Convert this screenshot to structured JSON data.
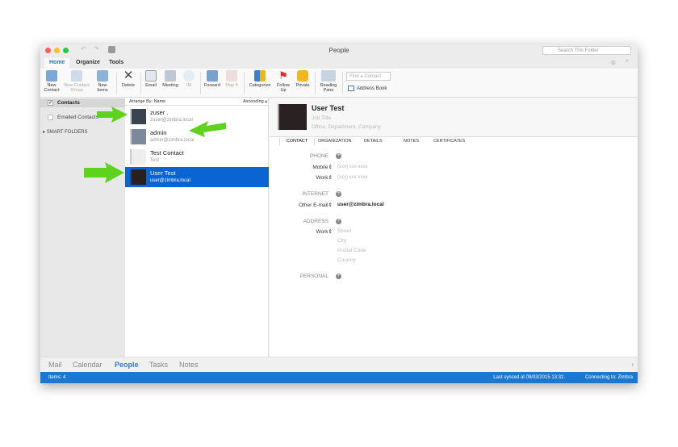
{
  "window": {
    "title": "People",
    "search_placeholder": "Search This Folder"
  },
  "tabs": [
    "Home",
    "Organize",
    "Tools"
  ],
  "ribbon": [
    {
      "label": "New Contact",
      "icon": "new-contact-icon",
      "enabled": true
    },
    {
      "label": "New Contact Group",
      "icon": "new-group-icon",
      "enabled": false
    },
    {
      "label": "New Items",
      "icon": "new-items-icon",
      "enabled": true
    },
    {
      "label": "Delete",
      "icon": "delete-icon",
      "enabled": true
    },
    {
      "label": "Email",
      "icon": "email-icon",
      "enabled": true
    },
    {
      "label": "Meeting",
      "icon": "meeting-icon",
      "enabled": true
    },
    {
      "label": "IM",
      "icon": "im-icon",
      "enabled": false
    },
    {
      "label": "Forward",
      "icon": "forward-icon",
      "enabled": true
    },
    {
      "label": "Map It",
      "icon": "map-icon",
      "enabled": false
    },
    {
      "label": "Categorize",
      "icon": "categorize-icon",
      "enabled": true
    },
    {
      "label": "Follow Up",
      "icon": "flag-icon",
      "enabled": true
    },
    {
      "label": "Private",
      "icon": "lock-icon",
      "enabled": true
    },
    {
      "label": "Reading Pane",
      "icon": "reading-pane-icon",
      "enabled": true
    }
  ],
  "find_contact_placeholder": "Find a Contact",
  "address_book": "Address Book",
  "sidebar": {
    "contacts": "Contacts",
    "emailed": "Emailed Contacts",
    "smart": "SMART FOLDERS"
  },
  "list": {
    "arrange": "Arrange By: Name",
    "order": "Ascending",
    "items": [
      {
        "name": "zuser .",
        "email": "zuser@zimbra.local"
      },
      {
        "name": "admin",
        "email": "admin@zimbra.local"
      },
      {
        "name": "Test Contact",
        "email": "Test"
      },
      {
        "name": "User Test",
        "email": "user@zimbra.local",
        "selected": true
      }
    ]
  },
  "detail": {
    "name": "User Test",
    "job_title": "Job Title",
    "office": "Office,  Department,  Company",
    "tabs": [
      "CONTACT",
      "ORGANIZATION",
      "DETAILS",
      "NOTES",
      "CERTIFICATES"
    ],
    "phone": "PHONE",
    "mobile": "Mobile",
    "work": "Work",
    "phone_ph": "(xxx) xxx-xxxx",
    "internet": "INTERNET",
    "other_email": "Other E-mail",
    "email_val": "user@zimbra.local",
    "address": "ADDRESS",
    "street": "Street",
    "city": "City",
    "postal": "Postal Code",
    "country": "Country",
    "personal": "PERSONAL"
  },
  "nav": [
    "Mail",
    "Calendar",
    "People",
    "Tasks",
    "Notes"
  ],
  "status": {
    "items": "Items: 4",
    "synced": "Last synced at 09/03/2015 13:32.",
    "connecting": "Connecting to: Zimbra"
  },
  "colors": {
    "accent": "#1a78d2",
    "selected": "#0a64d2",
    "arrow": "#5fd21e"
  }
}
